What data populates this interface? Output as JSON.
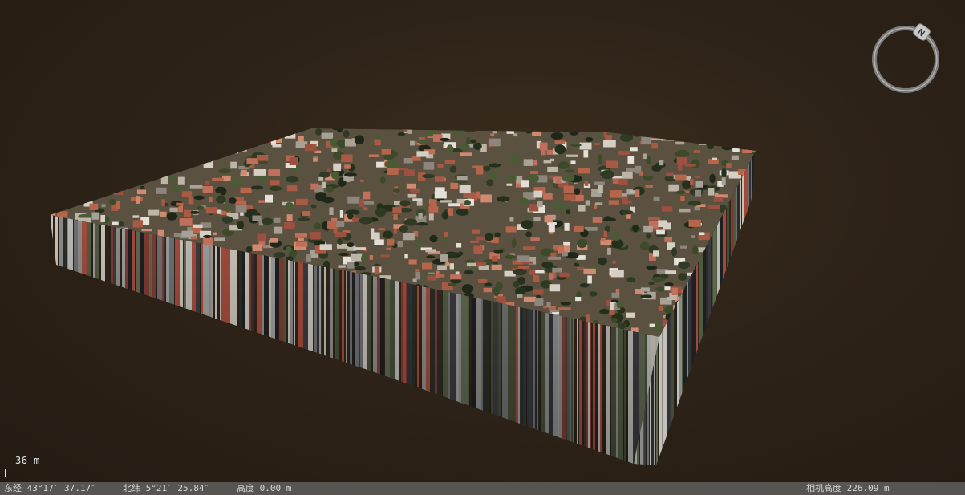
{
  "compass": {
    "north_label": "N"
  },
  "scale": {
    "label": "36 m"
  },
  "statusbar": {
    "east": "东经 43°17′ 37.17″",
    "north": "北纬 5°21′ 25.84″",
    "altitude": "高度 0.00 m",
    "camera_altitude": "相机高度 226.09 m"
  },
  "colors": {
    "background": "#2e2318",
    "statusbar": "#575552",
    "compass_ring": "#8a8a8a",
    "roof": "#b5654a"
  }
}
